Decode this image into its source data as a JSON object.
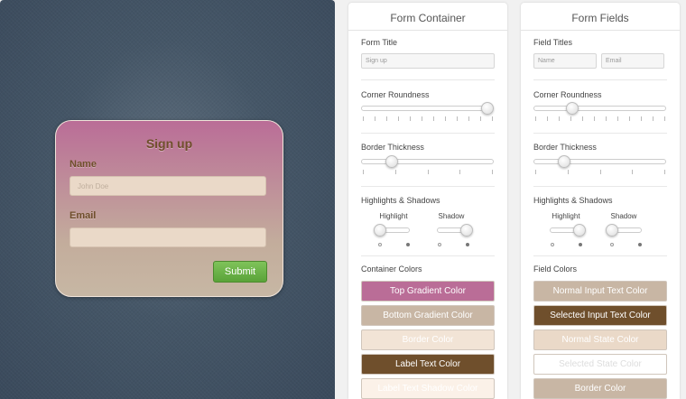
{
  "preview": {
    "form_title": "Sign up",
    "name_label": "Name",
    "name_placeholder": "John Doe",
    "email_label": "Email",
    "email_value": "",
    "submit_label": "Submit"
  },
  "container_panel": {
    "title": "Form Container",
    "form_title_label": "Form Title",
    "form_title_value": "Sign up",
    "corner_label": "Corner Roundness",
    "corner_value": 1.0,
    "border_label": "Border Thickness",
    "border_value": 0.2,
    "highlights_label": "Highlights & Shadows",
    "highlight_label": "Highlight",
    "highlight_value": 0,
    "shadow_label": "Shadow",
    "shadow_value": 1,
    "colors_label": "Container Colors",
    "colors": [
      {
        "label": "Top Gradient Color",
        "bg": "#ba6d97",
        "fg": "#ffffff"
      },
      {
        "label": "Bottom Gradient Color",
        "bg": "#c8b6a4",
        "fg": "#ffffff"
      },
      {
        "label": "Border Color",
        "bg": "#f2e4d6",
        "fg": "#ffffff"
      },
      {
        "label": "Label Text Color",
        "bg": "#6f4f2c",
        "fg": "#ffffff"
      },
      {
        "label": "Label Text Shadow Color",
        "bg": "#fbf1e8",
        "fg": "#ffffff"
      }
    ]
  },
  "fields_panel": {
    "title": "Form Fields",
    "field_titles_label": "Field Titles",
    "field_title_1": "Name",
    "field_title_2": "Email",
    "corner_label": "Corner Roundness",
    "corner_value": 0.27,
    "border_label": "Border Thickness",
    "border_value": 0.2,
    "highlights_label": "Highlights & Shadows",
    "highlight_label": "Highlight",
    "highlight_value": 1,
    "shadow_label": "Shadow",
    "shadow_value": 0,
    "colors_label": "Field Colors",
    "colors": [
      {
        "label": "Normal Input Text Color",
        "bg": "#c8b6a4",
        "fg": "#ffffff"
      },
      {
        "label": "Selected Input Text Color",
        "bg": "#6f4f2c",
        "fg": "#ffffff"
      },
      {
        "label": "Normal State Color",
        "bg": "#ead9c8",
        "fg": "#ffffff"
      },
      {
        "label": "Selected State Color",
        "bg": "#ffffff",
        "fg": "#dddddd"
      },
      {
        "label": "Border Color",
        "bg": "#c8b6a4",
        "fg": "#ffffff"
      }
    ]
  }
}
